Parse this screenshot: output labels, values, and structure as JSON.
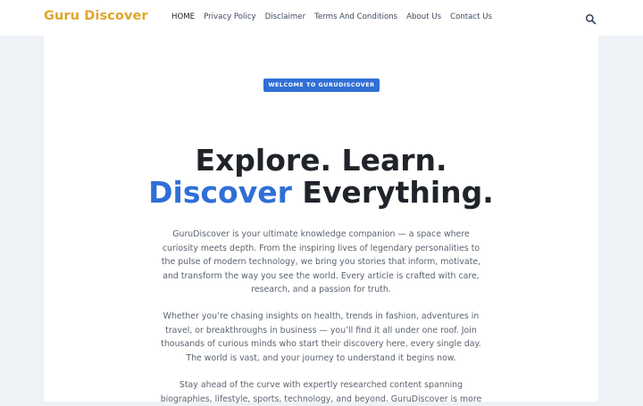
{
  "header": {
    "brand": "Guru Discover",
    "nav": [
      {
        "label": "HOME",
        "active": true
      },
      {
        "label": "Privacy Policy",
        "active": false
      },
      {
        "label": "Disclaimer",
        "active": false
      },
      {
        "label": "Terms And Conditions",
        "active": false
      },
      {
        "label": "About Us",
        "active": false
      },
      {
        "label": "Contact Us",
        "active": false
      }
    ],
    "search_icon": "search-icon"
  },
  "hero": {
    "badge": "WELCOME TO GURUDISCOVER",
    "headline_line1": "Explore. Learn.",
    "headline_accent": "Discover",
    "headline_line2_rest": " Everything.",
    "paragraphs": [
      "GuruDiscover is your ultimate knowledge companion — a space where curiosity meets depth. From the inspiring lives of legendary personalities to the pulse of modern technology, we bring you stories that inform, motivate, and transform the way you see the world. Every article is crafted with care, research, and a passion for truth.",
      "Whether you’re chasing insights on health, trends in fashion, adventures in travel, or breakthroughs in business — you’ll find it all under one roof. Join thousands of curious minds who start their discovery here, every single day. The world is vast, and your journey to understand it begins now.",
      "Stay ahead of the curve with expertly researched content spanning biographies, lifestyle, sports, technology, and beyond. GuruDiscover is more"
    ]
  },
  "colors": {
    "brand": "#e0a52a",
    "accent": "#2f6fd6",
    "page_bg": "#eef1f5",
    "card_bg": "#ffffff",
    "text_dark": "#20242a",
    "text_muted": "#5b6470"
  }
}
